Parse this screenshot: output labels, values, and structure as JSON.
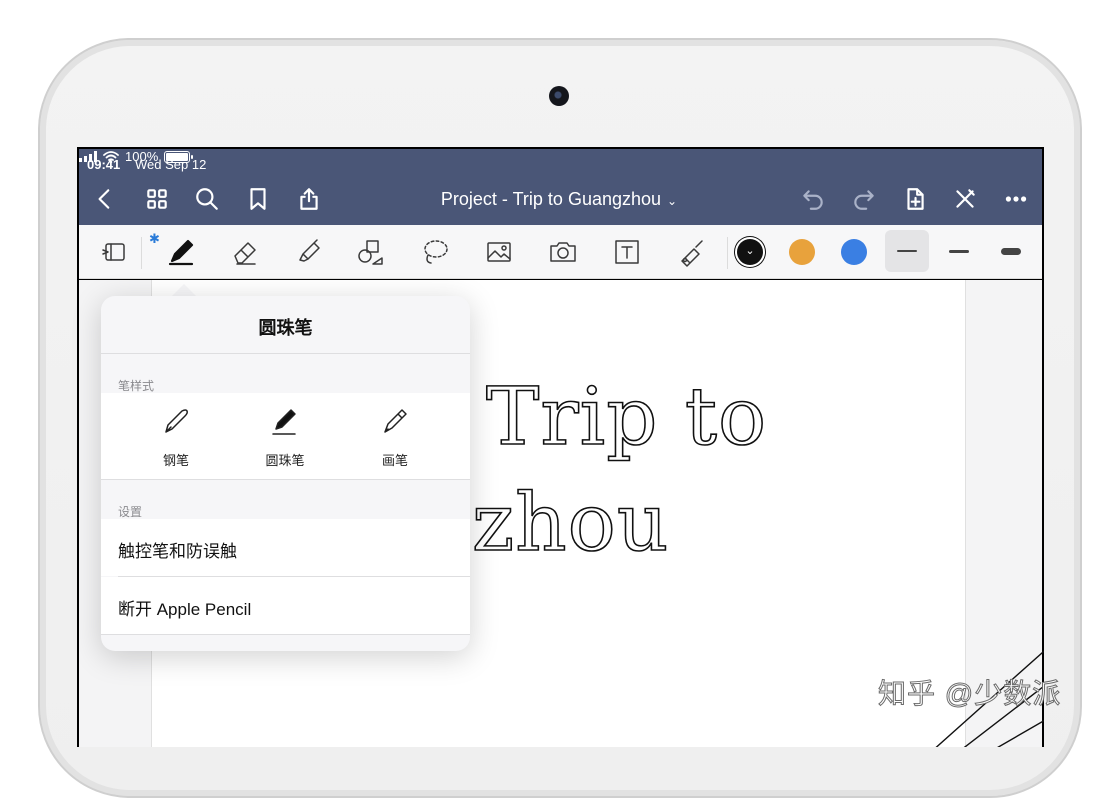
{
  "status_bar": {
    "time": "09:41",
    "date": "Wed Sep 12",
    "battery": "100%"
  },
  "nav": {
    "title": "Project - Trip to Guangzhou",
    "icons": [
      "back-chevron-icon",
      "grid-icon",
      "search-icon",
      "bookmark-icon",
      "share-icon",
      "undo-icon",
      "redo-icon",
      "add-page-icon",
      "close-x-icon",
      "more-icon"
    ]
  },
  "toolbar": {
    "tools": [
      "read-mode-icon",
      "pen-icon",
      "eraser-icon",
      "highlighter-icon",
      "shapes-icon",
      "lasso-icon",
      "image-icon",
      "camera-icon",
      "text-box-icon",
      "laser-pointer-icon"
    ],
    "bluetooth_badge": "✱",
    "colors": [
      "#111111",
      "#e8a23c",
      "#3a7fe3"
    ],
    "selected_color": "#111111",
    "stroke_widths": [
      "thin",
      "medium",
      "thick"
    ],
    "selected_stroke": "thin"
  },
  "note": {
    "line1": "Trip to",
    "line2": "zhou"
  },
  "popover": {
    "title": "圆珠笔",
    "pen_style_header": "笔样式",
    "pen_styles": [
      {
        "label": "钢笔",
        "icon": "fountain-pen-icon"
      },
      {
        "label": "圆珠笔",
        "icon": "ballpoint-pen-icon",
        "selected": true
      },
      {
        "label": "画笔",
        "icon": "brush-pen-icon"
      }
    ],
    "settings_header": "设置",
    "settings": [
      "触控笔和防误触",
      "断开 Apple Pencil"
    ]
  },
  "watermark": "知乎 @少数派"
}
